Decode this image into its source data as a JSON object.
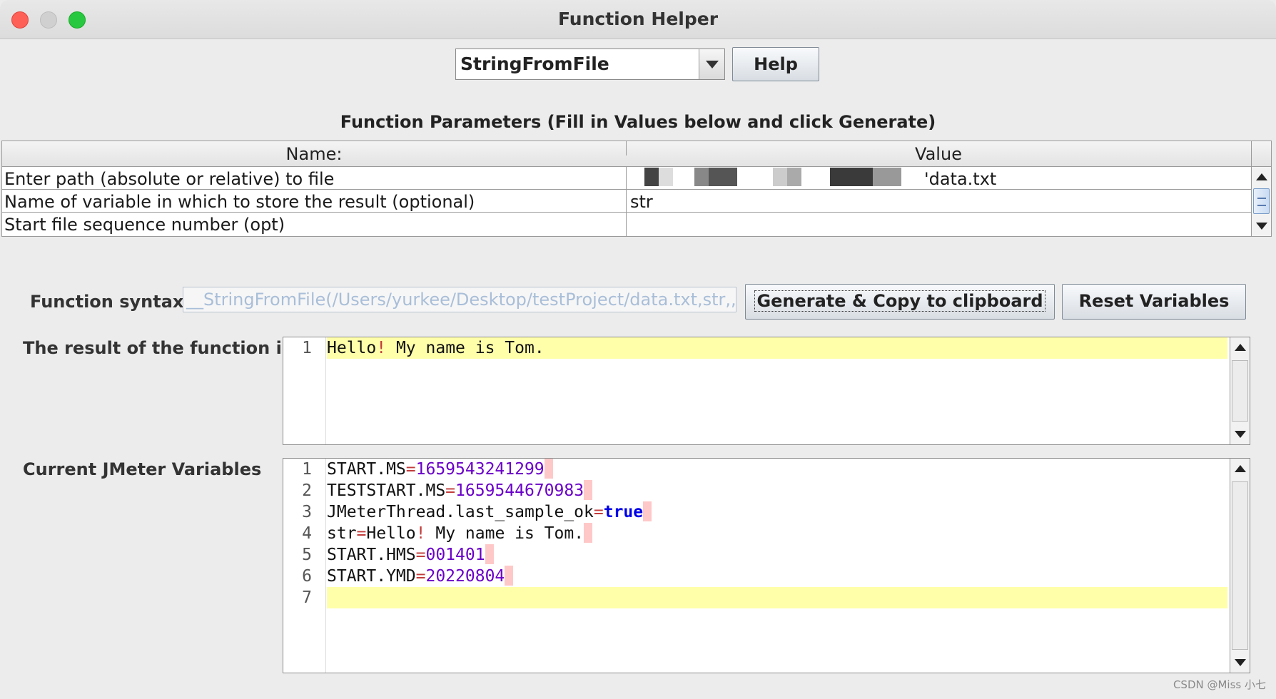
{
  "window": {
    "title": "Function Helper"
  },
  "function_select": {
    "selected": "StringFromFile",
    "help_label": "Help"
  },
  "parameters": {
    "title": "Function Parameters (Fill in Values below and click Generate)",
    "headers": {
      "name": "Name:",
      "value": "Value"
    },
    "rows": [
      {
        "name": "Enter path (absolute or relative) to file",
        "value": "'data.txt"
      },
      {
        "name": "Name of variable in which to store the result (optional)",
        "value": "str"
      },
      {
        "name": "Start file sequence number (opt)",
        "value": ""
      }
    ]
  },
  "syntax": {
    "label": "Function syntax:",
    "value": "__StringFromFile(/Users/yurkee/Desktop/testProject/data.txt,str,,)}",
    "generate_label": "Generate & Copy to clipboard",
    "reset_label": "Reset Variables"
  },
  "result": {
    "label": "The result of the function is",
    "lines": [
      {
        "num": "1",
        "text_a": "Hello",
        "text_op": "!",
        "text_b": " My name is Tom."
      }
    ]
  },
  "variables": {
    "label": "Current JMeter Variables",
    "line_numbers": [
      "1",
      "2",
      "3",
      "4",
      "5",
      "6",
      "7"
    ],
    "lines": [
      {
        "key": "START.MS",
        "eq": "=",
        "value": "1659543241299"
      },
      {
        "key": "TESTSTART.MS",
        "eq": "=",
        "value": "1659544670983"
      },
      {
        "key": "JMeterThread.last_sample_ok",
        "eq": "=",
        "value": "true"
      },
      {
        "key": "str",
        "eq": "=",
        "value_a": "Hello",
        "value_op": "!",
        "value_b": " My name is Tom."
      },
      {
        "key": "START.HMS",
        "eq": "=",
        "value": "001401"
      },
      {
        "key": "START.YMD",
        "eq": "=",
        "value": "20220804"
      }
    ]
  },
  "watermark": "CSDN @Miss 小七",
  "colors": {
    "current_line": "#ffffaa",
    "number": "#6a00c8",
    "boolean": "#0000e6",
    "operator": "#c23b3b",
    "close": "#fe5f57",
    "maximize": "#28c840"
  }
}
